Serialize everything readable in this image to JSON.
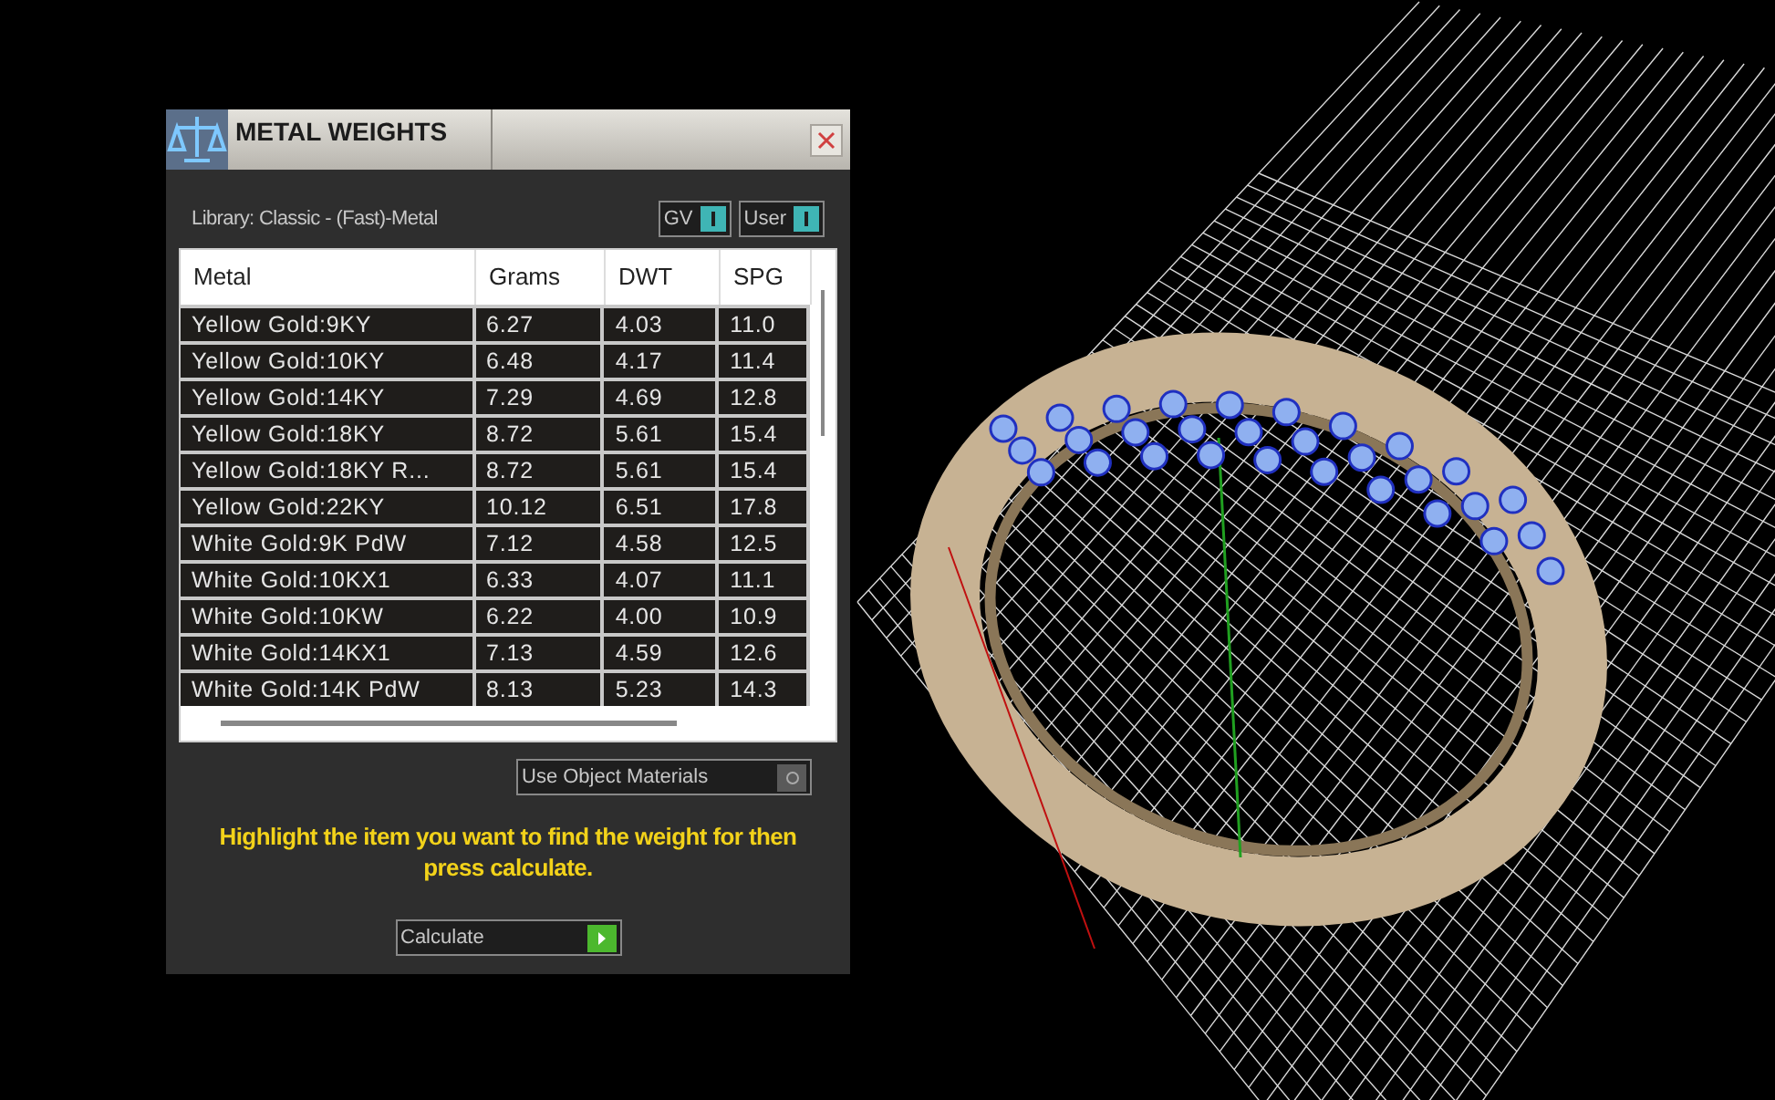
{
  "window": {
    "title": "METAL WEIGHTS"
  },
  "library": {
    "label": "Library: Classic - (Fast)-Metal"
  },
  "toggles": [
    {
      "label": "GV",
      "on": true
    },
    {
      "label": "User",
      "on": true
    }
  ],
  "table": {
    "columns": [
      "Metal",
      "Grams",
      "DWT",
      "SPG"
    ],
    "rows": [
      [
        "Yellow Gold:9KY",
        "6.27",
        "4.03",
        "11.0"
      ],
      [
        "Yellow Gold:10KY",
        "6.48",
        "4.17",
        "11.4"
      ],
      [
        "Yellow Gold:14KY",
        "7.29",
        "4.69",
        "12.8"
      ],
      [
        "Yellow Gold:18KY",
        "8.72",
        "5.61",
        "15.4"
      ],
      [
        "Yellow Gold:18KY R...",
        "8.72",
        "5.61",
        "15.4"
      ],
      [
        "Yellow Gold:22KY",
        "10.12",
        "6.51",
        "17.8"
      ],
      [
        "White Gold:9K PdW",
        "7.12",
        "4.58",
        "12.5"
      ],
      [
        "White Gold:10KX1",
        "6.33",
        "4.07",
        "11.1"
      ],
      [
        "White Gold:10KW",
        "6.22",
        "4.00",
        "10.9"
      ],
      [
        "White Gold:14KX1",
        "7.13",
        "4.59",
        "12.6"
      ],
      [
        "White Gold:14K PdW",
        "8.13",
        "5.23",
        "14.3"
      ]
    ]
  },
  "use_object_materials": {
    "label": "Use Object Materials",
    "on": false
  },
  "hint": "Highlight the item you want to find the weight for then press calculate.",
  "calculate_button": {
    "label": "Calculate"
  }
}
